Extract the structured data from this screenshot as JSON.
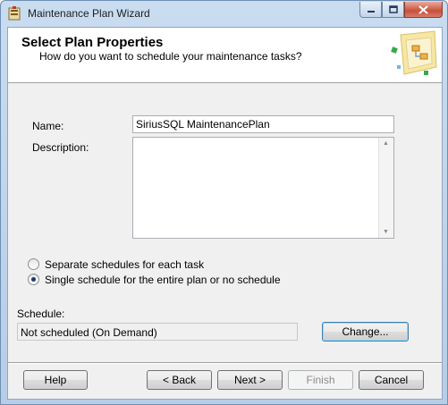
{
  "window": {
    "title": "Maintenance Plan Wizard"
  },
  "header": {
    "title": "Select Plan Properties",
    "subtitle": "How do you want to schedule your maintenance tasks?"
  },
  "form": {
    "name_label": "Name:",
    "name_value": "SiriusSQL MaintenancePlan",
    "description_label": "Description:",
    "description_value": ""
  },
  "schedule_options": [
    {
      "label": "Separate schedules for each task",
      "selected": false
    },
    {
      "label": "Single schedule for the entire plan or no schedule",
      "selected": true
    }
  ],
  "schedule": {
    "label": "Schedule:",
    "value": "Not scheduled (On Demand)",
    "change_button": "Change..."
  },
  "buttons": {
    "help": "Help",
    "back": "< Back",
    "next": "Next >",
    "finish": "Finish",
    "cancel": "Cancel"
  }
}
